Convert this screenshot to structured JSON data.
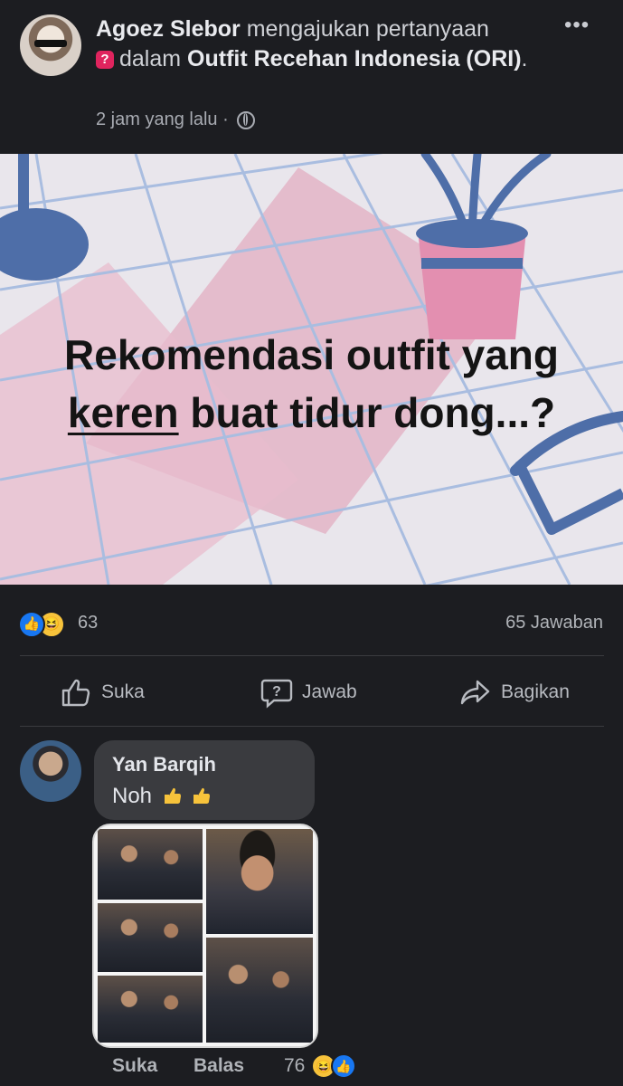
{
  "post": {
    "author": "Agoez Slebor",
    "action_text": "mengajukan pertanyaan",
    "in_text": "dalam",
    "group": "Outfit Recehan Indonesia (ORI)",
    "time": "2 jam yang lalu ·"
  },
  "banner": {
    "line1": "Rekomendasi outfit yang",
    "underlined": "keren",
    "line2_rest": "buat tidur dong...?"
  },
  "stats": {
    "reaction_count": "63",
    "answers": "65 Jawaban"
  },
  "actions": {
    "like": "Suka",
    "answer": "Jawab",
    "share": "Bagikan"
  },
  "comment": {
    "author": "Yan Barqih",
    "text": "Noh",
    "like": "Suka",
    "reply": "Balas",
    "reaction_count": "76"
  },
  "colors": {
    "background": "#1c1d21",
    "bubble": "#3a3b3f",
    "like_blue": "#1877f2",
    "question_red": "#e0245e"
  }
}
